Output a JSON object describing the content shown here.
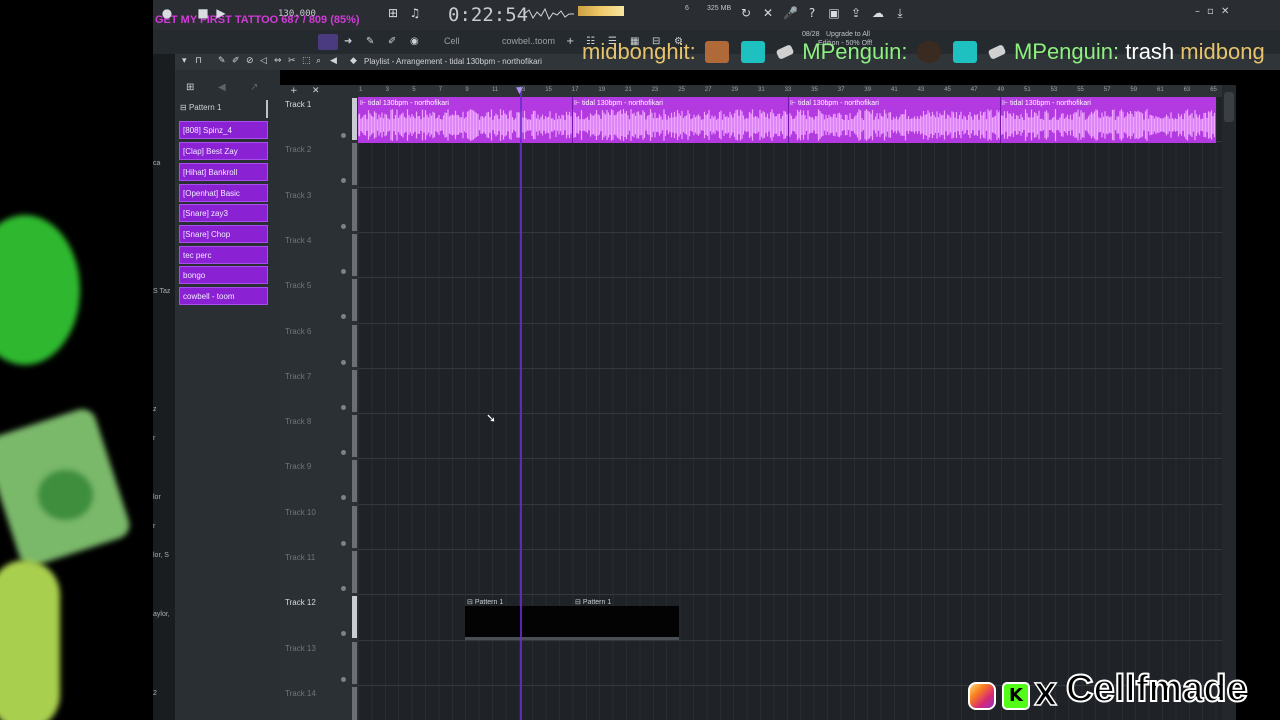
{
  "stream_overlay": {
    "song_banner": "GET MY FIRST TATTOO 687 / 809 (85%)",
    "chat": {
      "messages": [
        {
          "user": "midbonghit:",
          "text": ""
        },
        {
          "user": "MPenguin:",
          "text": ""
        },
        {
          "user": "MPenguin:",
          "text": "trash"
        },
        {
          "user": "midbong",
          "text": ""
        }
      ]
    },
    "social": {
      "handle": "Cellfmade",
      "x_glyph": "X",
      "kick_glyph": "K"
    },
    "left_strip_labels": [
      "ca",
      "S Taz",
      "z",
      "r",
      "lor",
      "r",
      "lor, S",
      "aylor,",
      "2"
    ]
  },
  "toolbar": {
    "tempo": "130.000",
    "time": "0:22:54",
    "memory": "325 MB",
    "cpu": "6",
    "upgrade_date": "08/28",
    "upgrade_text": "Upgrade to All",
    "upgrade_sub": "Edition - 50% Off!",
    "snap": "Cell",
    "pattern_file": "cowbel..toom",
    "icons": [
      "metronome-icon",
      "loop-icon",
      "mic-icon",
      "help-icon",
      "save-icon",
      "export-icon",
      "chat-icon",
      "download-icon"
    ]
  },
  "playlist": {
    "title": "Playlist - Arrangement",
    "clip_name": "tidal 130bpm - northofikari",
    "ruler": [
      "1",
      "3",
      "5",
      "7",
      "9",
      "11",
      "13",
      "15",
      "17",
      "19",
      "21",
      "23",
      "25",
      "27",
      "29",
      "31",
      "33",
      "35",
      "37",
      "39",
      "41",
      "43",
      "45",
      "47",
      "49",
      "51",
      "53",
      "55",
      "57",
      "59",
      "61",
      "63",
      "65"
    ],
    "audio_clips": [
      "tidal 130bpm - northofikari",
      "tidal 130bpm - northofikari",
      "tidal 130bpm - northofikari",
      "tidal 130bpm - northofikari"
    ],
    "pattern_clips": [
      "Pattern 1",
      "Pattern 1"
    ],
    "tracks": [
      "Track 1",
      "Track 2",
      "Track 3",
      "Track 4",
      "Track 5",
      "Track 6",
      "Track 7",
      "Track 8",
      "Track 9",
      "Track 10",
      "Track 11",
      "Track 12",
      "Track 13",
      "Track 14"
    ]
  },
  "channel_rack": {
    "pattern": "Pattern 1",
    "channels": [
      "[808] Spinz_4",
      "[Clap] Best Zay",
      "[Hihat] Bankroll",
      "[Openhat] Basic",
      "[Snare] zay3",
      "[Snare] Chop",
      "tec perc",
      "bongo",
      "cowbell - toom"
    ]
  },
  "colors": {
    "clip_purple": "#b23ae0",
    "channel_purple": "#8a22d4",
    "playhead": "#6a2bd0"
  }
}
